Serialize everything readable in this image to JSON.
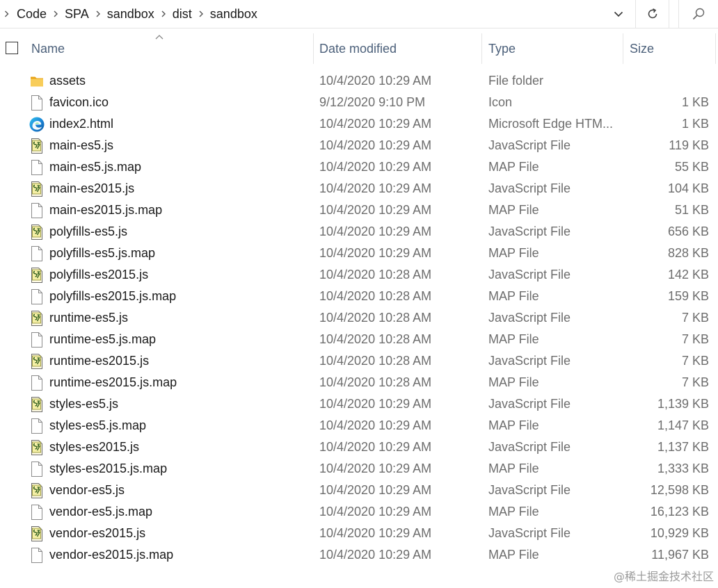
{
  "breadcrumb": [
    "Code",
    "SPA",
    "sandbox",
    "dist",
    "sandbox"
  ],
  "columns": {
    "name": "Name",
    "date_modified": "Date modified",
    "type": "Type",
    "size": "Size"
  },
  "sort": {
    "column": "name",
    "direction": "ascending"
  },
  "files": [
    {
      "name": "assets",
      "date": "10/4/2020 10:29 AM",
      "type": "File folder",
      "size": "",
      "icon": "folder-icon"
    },
    {
      "name": "favicon.ico",
      "date": "9/12/2020 9:10 PM",
      "type": "Icon",
      "size": "1 KB",
      "icon": "file-icon"
    },
    {
      "name": "index2.html",
      "date": "10/4/2020 10:29 AM",
      "type": "Microsoft Edge HTM...",
      "size": "1 KB",
      "icon": "edge-icon"
    },
    {
      "name": "main-es5.js",
      "date": "10/4/2020 10:29 AM",
      "type": "JavaScript File",
      "size": "119 KB",
      "icon": "javascript-file-icon"
    },
    {
      "name": "main-es5.js.map",
      "date": "10/4/2020 10:29 AM",
      "type": "MAP File",
      "size": "55 KB",
      "icon": "file-icon"
    },
    {
      "name": "main-es2015.js",
      "date": "10/4/2020 10:29 AM",
      "type": "JavaScript File",
      "size": "104 KB",
      "icon": "javascript-file-icon"
    },
    {
      "name": "main-es2015.js.map",
      "date": "10/4/2020 10:29 AM",
      "type": "MAP File",
      "size": "51 KB",
      "icon": "file-icon"
    },
    {
      "name": "polyfills-es5.js",
      "date": "10/4/2020 10:29 AM",
      "type": "JavaScript File",
      "size": "656 KB",
      "icon": "javascript-file-icon"
    },
    {
      "name": "polyfills-es5.js.map",
      "date": "10/4/2020 10:29 AM",
      "type": "MAP File",
      "size": "828 KB",
      "icon": "file-icon"
    },
    {
      "name": "polyfills-es2015.js",
      "date": "10/4/2020 10:28 AM",
      "type": "JavaScript File",
      "size": "142 KB",
      "icon": "javascript-file-icon"
    },
    {
      "name": "polyfills-es2015.js.map",
      "date": "10/4/2020 10:28 AM",
      "type": "MAP File",
      "size": "159 KB",
      "icon": "file-icon"
    },
    {
      "name": "runtime-es5.js",
      "date": "10/4/2020 10:28 AM",
      "type": "JavaScript File",
      "size": "7 KB",
      "icon": "javascript-file-icon"
    },
    {
      "name": "runtime-es5.js.map",
      "date": "10/4/2020 10:28 AM",
      "type": "MAP File",
      "size": "7 KB",
      "icon": "file-icon"
    },
    {
      "name": "runtime-es2015.js",
      "date": "10/4/2020 10:28 AM",
      "type": "JavaScript File",
      "size": "7 KB",
      "icon": "javascript-file-icon"
    },
    {
      "name": "runtime-es2015.js.map",
      "date": "10/4/2020 10:28 AM",
      "type": "MAP File",
      "size": "7 KB",
      "icon": "file-icon"
    },
    {
      "name": "styles-es5.js",
      "date": "10/4/2020 10:29 AM",
      "type": "JavaScript File",
      "size": "1,139 KB",
      "icon": "javascript-file-icon"
    },
    {
      "name": "styles-es5.js.map",
      "date": "10/4/2020 10:29 AM",
      "type": "MAP File",
      "size": "1,147 KB",
      "icon": "file-icon"
    },
    {
      "name": "styles-es2015.js",
      "date": "10/4/2020 10:29 AM",
      "type": "JavaScript File",
      "size": "1,137 KB",
      "icon": "javascript-file-icon"
    },
    {
      "name": "styles-es2015.js.map",
      "date": "10/4/2020 10:29 AM",
      "type": "MAP File",
      "size": "1,333 KB",
      "icon": "file-icon"
    },
    {
      "name": "vendor-es5.js",
      "date": "10/4/2020 10:29 AM",
      "type": "JavaScript File",
      "size": "12,598 KB",
      "icon": "javascript-file-icon"
    },
    {
      "name": "vendor-es5.js.map",
      "date": "10/4/2020 10:29 AM",
      "type": "MAP File",
      "size": "16,123 KB",
      "icon": "file-icon"
    },
    {
      "name": "vendor-es2015.js",
      "date": "10/4/2020 10:29 AM",
      "type": "JavaScript File",
      "size": "10,929 KB",
      "icon": "javascript-file-icon"
    },
    {
      "name": "vendor-es2015.js.map",
      "date": "10/4/2020 10:29 AM",
      "type": "MAP File",
      "size": "11,967 KB",
      "icon": "file-icon"
    }
  ],
  "watermark": "@稀土掘金技术社区",
  "colors": {
    "header_text": "#4c607a",
    "secondary_text": "#6d6d6d",
    "folder": "#f5c242",
    "divider": "#e5e5e5"
  }
}
